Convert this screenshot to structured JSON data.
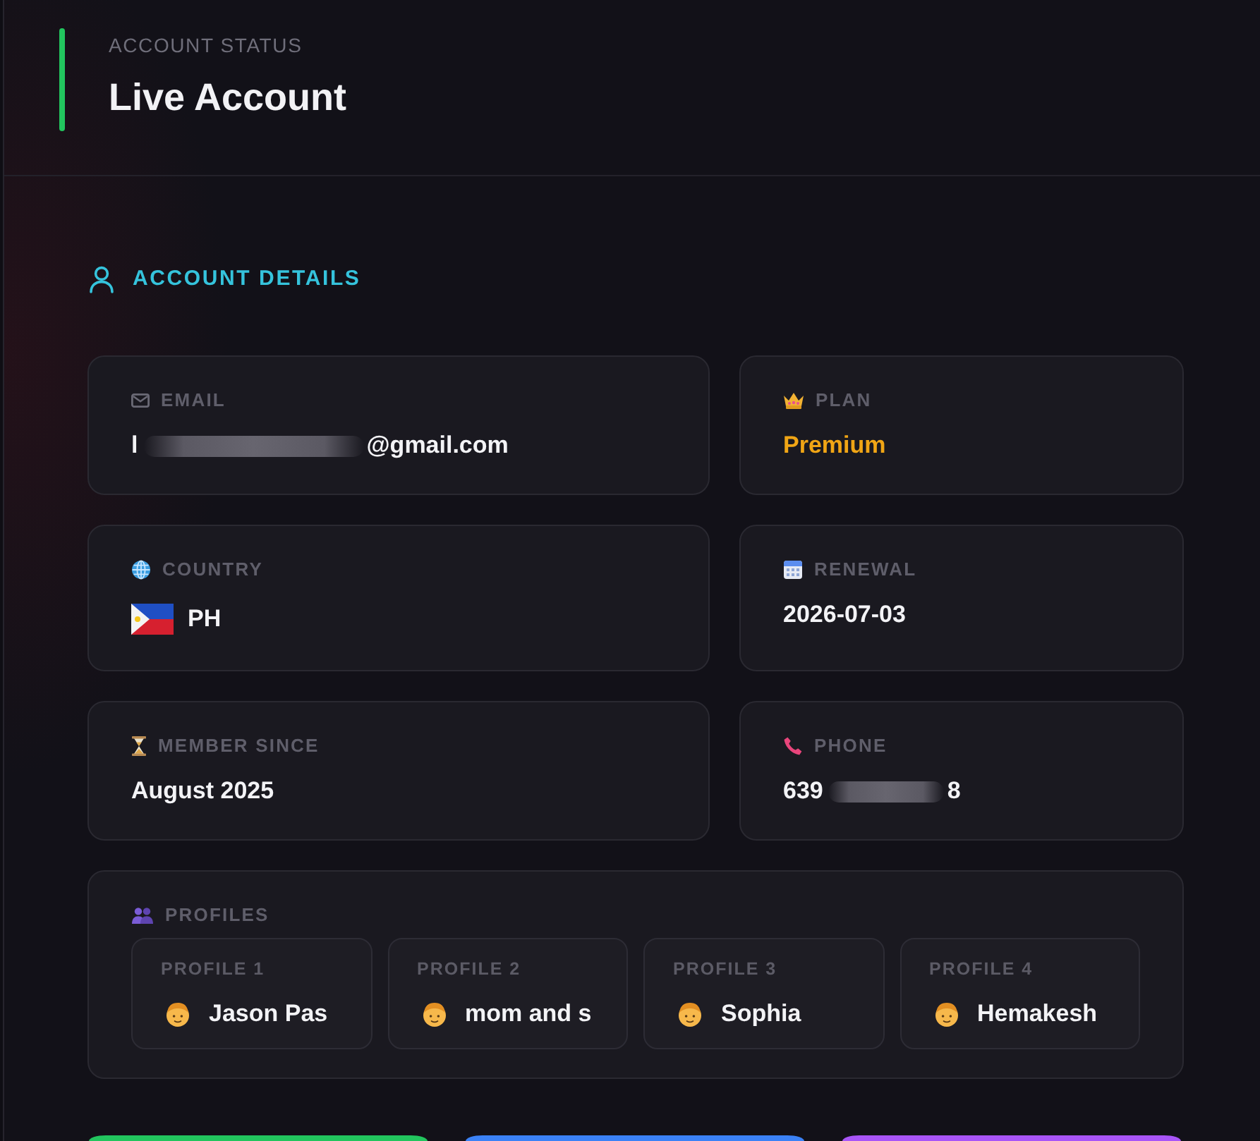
{
  "header": {
    "caption": "ACCOUNT STATUS",
    "title": "Live Account"
  },
  "section": {
    "title": "ACCOUNT DETAILS"
  },
  "details": [
    {
      "kind": "email",
      "label": "EMAIL",
      "value": "l",
      "redacted": true,
      "value_after": "@gmail.com"
    },
    {
      "kind": "plan",
      "label": "PLAN",
      "value": "Premium",
      "redacted": false
    },
    {
      "kind": "country",
      "label": "COUNTRY",
      "value": "PH",
      "redacted": false
    },
    {
      "kind": "renewal",
      "label": "RENEWAL",
      "value": "2026-07-03",
      "redacted": false
    },
    {
      "kind": "since",
      "label": "MEMBER SINCE",
      "value": "August 2025",
      "redacted": false
    },
    {
      "kind": "phone",
      "label": "PHONE",
      "value": "639",
      "redacted": true,
      "value_after": "8"
    }
  ],
  "profiles": {
    "label": "PROFILES",
    "items": [
      {
        "label": "PROFILE 1",
        "name": "Jason Pas"
      },
      {
        "label": "PROFILE 2",
        "name": "mom and s"
      },
      {
        "label": "PROFILE 3",
        "name": "Sophia"
      },
      {
        "label": "PROFILE 4",
        "name": "Hemakesh"
      }
    ]
  },
  "action_buttons": [
    {
      "color": "#22c55e"
    },
    {
      "color": "#3b82f6"
    },
    {
      "color": "#a855f7"
    }
  ]
}
